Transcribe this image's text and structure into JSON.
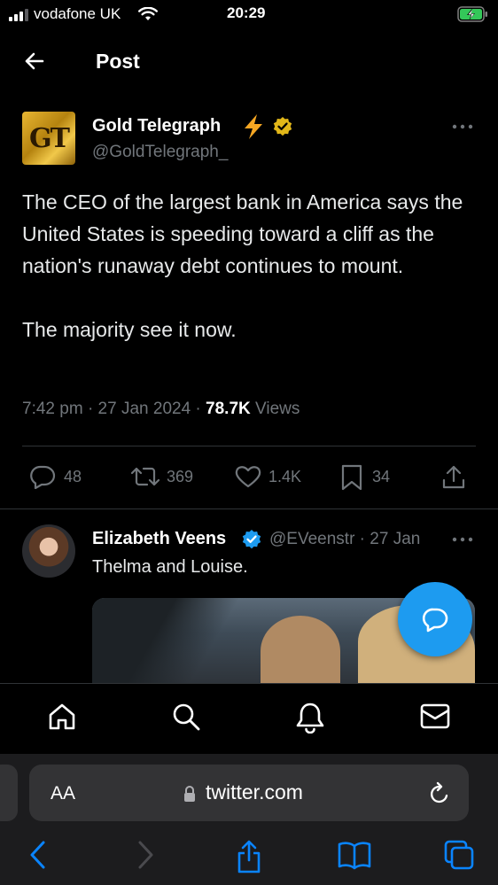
{
  "status_bar": {
    "carrier": "vodafone UK",
    "time": "20:29"
  },
  "header": {
    "title": "Post"
  },
  "tweet": {
    "author_name": "Gold Telegraph",
    "author_handle": "@GoldTelegraph_",
    "avatar_text": "GT",
    "text": "The CEO of the largest bank in America says the United States is speeding toward a cliff as the nation's runaway debt continues to mount.\n\nThe majority see it now.",
    "time": "7:42 pm",
    "date": "27 Jan 2024",
    "views_count": "78.7K",
    "views_label": "Views",
    "replies": "48",
    "reposts": "369",
    "likes": "1.4K",
    "bookmarks": "34"
  },
  "reply": {
    "author_name": "Elizabeth Veens",
    "author_handle": "@EVeenstr",
    "date": "27 Jan",
    "text": "Thelma and Louise."
  },
  "browser": {
    "aa_label": "AA",
    "url": "twitter.com"
  },
  "colors": {
    "accent": "#1d9bf0",
    "verified_gold": "#e2b719",
    "bolt": "#f5a623",
    "muted": "#71767b"
  }
}
